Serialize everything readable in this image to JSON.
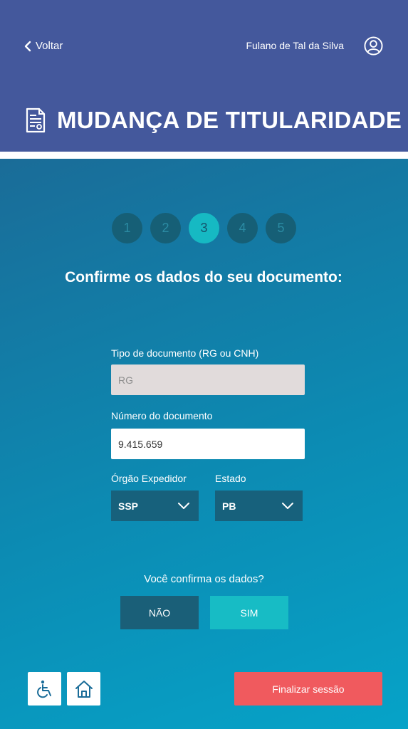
{
  "header": {
    "back_label": "Voltar",
    "user_name": "Fulano de Tal da Silva",
    "title": "MUDANÇA DE TITULARIDADE",
    "background_color": "#44589c",
    "icons": [
      "chevron-left-icon",
      "user-icon",
      "document-icon"
    ]
  },
  "steps": {
    "items": [
      "1",
      "2",
      "3",
      "4",
      "5"
    ],
    "active": "3"
  },
  "form": {
    "question": "Confirme os dados do seu documento:",
    "doc_type_label": "Tipo de documento (RG ou CNH)",
    "doc_type_value": "RG",
    "doc_number_label": "Número do documento",
    "doc_number_value": "9.415.659",
    "issuer_label": "Órgão Expedidor",
    "issuer_value": "SSP",
    "state_label": "Estado",
    "state_value": "PB"
  },
  "confirm": {
    "prompt": "Você confirma os dados?",
    "no_label": "NÃO",
    "yes_label": "SIM"
  },
  "footer": {
    "finalize_label": "Finalizar sessão",
    "finalize_color": "#f05a5e",
    "icons": [
      "wheelchair-icon",
      "home-icon"
    ]
  }
}
